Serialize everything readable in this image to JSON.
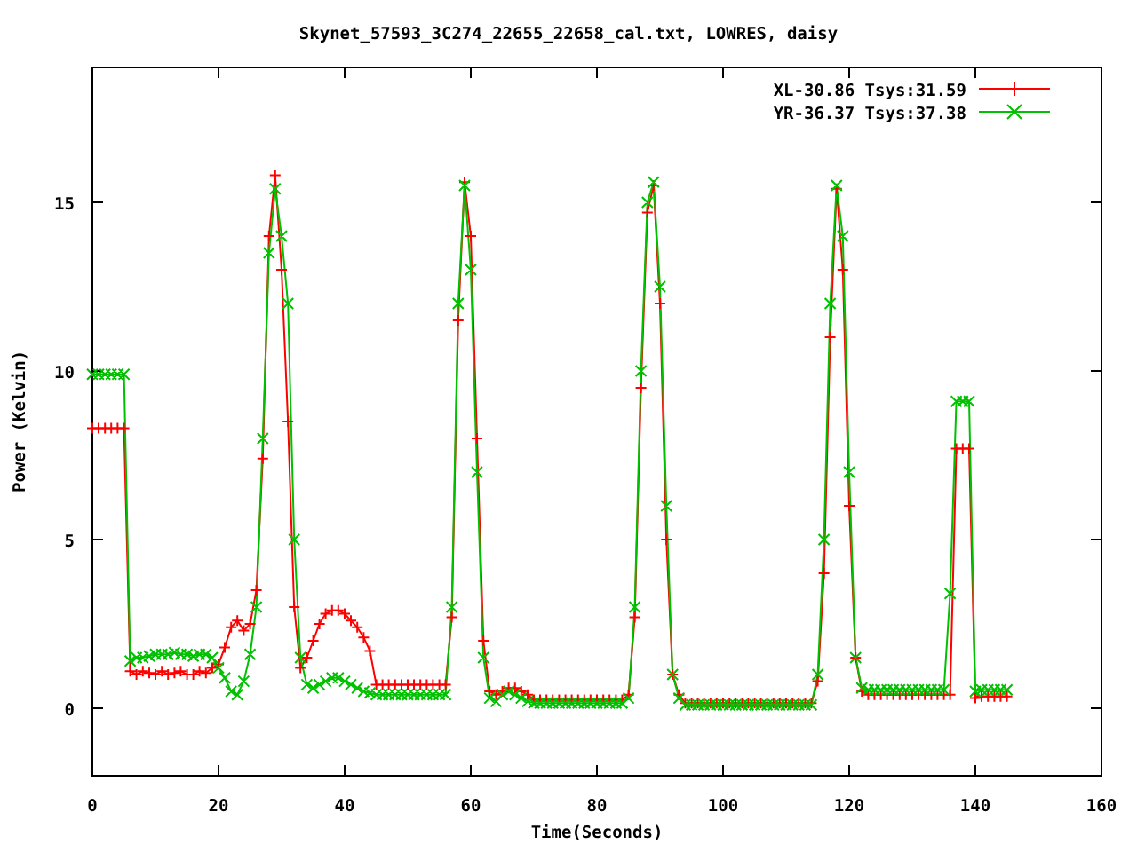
{
  "plot": {
    "chart_data": {
      "type": "line",
      "title": "Skynet_57593_3C274_22655_22658_cal.txt, LOWRES, daisy",
      "xlabel": "Time(Seconds)",
      "ylabel": "Power (Kelvin)",
      "x": [
        0,
        1,
        2,
        3,
        4,
        5,
        6,
        7,
        8,
        9,
        10,
        11,
        12,
        13,
        14,
        15,
        16,
        17,
        18,
        19,
        20,
        21,
        22,
        23,
        24,
        25,
        26,
        27,
        28,
        29,
        30,
        31,
        32,
        33,
        34,
        35,
        36,
        37,
        38,
        39,
        40,
        41,
        42,
        43,
        44,
        45,
        46,
        47,
        48,
        49,
        50,
        51,
        52,
        53,
        54,
        55,
        56,
        57,
        58,
        59,
        60,
        61,
        62,
        63,
        64,
        65,
        66,
        67,
        68,
        69,
        70,
        71,
        72,
        73,
        74,
        75,
        76,
        77,
        78,
        79,
        80,
        81,
        82,
        83,
        84,
        85,
        86,
        87,
        88,
        89,
        90,
        91,
        92,
        93,
        94,
        95,
        96,
        97,
        98,
        99,
        100,
        101,
        102,
        103,
        104,
        105,
        106,
        107,
        108,
        109,
        110,
        111,
        112,
        113,
        114,
        115,
        116,
        117,
        118,
        119,
        120,
        121,
        122,
        123,
        124,
        125,
        126,
        127,
        128,
        129,
        130,
        131,
        132,
        133,
        134,
        135,
        136,
        137,
        138,
        139,
        140,
        141,
        142,
        143,
        144,
        145
      ],
      "series": [
        {
          "name": "XL-30.86 Tsys:31.59",
          "color": "#ff0000",
          "marker": "plus",
          "values": [
            8.3,
            8.3,
            8.3,
            8.3,
            8.3,
            8.3,
            1.1,
            1.0,
            1.1,
            1.05,
            1.0,
            1.1,
            1.0,
            1.05,
            1.1,
            1.0,
            1.0,
            1.1,
            1.05,
            1.2,
            1.3,
            1.8,
            2.4,
            2.6,
            2.3,
            2.5,
            3.5,
            7.4,
            14,
            15.8,
            13,
            8.5,
            3,
            1.2,
            1.5,
            2,
            2.5,
            2.8,
            2.9,
            2.9,
            2.8,
            2.6,
            2.4,
            2.1,
            1.7,
            0.7,
            0.7,
            0.7,
            0.7,
            0.7,
            0.7,
            0.7,
            0.7,
            0.7,
            0.7,
            0.7,
            0.7,
            2.7,
            11.5,
            15.6,
            14,
            8,
            2,
            0.5,
            0.4,
            0.5,
            0.6,
            0.6,
            0.5,
            0.4,
            0.25,
            0.25,
            0.25,
            0.25,
            0.25,
            0.25,
            0.25,
            0.25,
            0.25,
            0.25,
            0.25,
            0.25,
            0.25,
            0.25,
            0.25,
            0.4,
            2.7,
            9.5,
            14.7,
            15.5,
            12,
            5,
            1,
            0.4,
            0.15,
            0.15,
            0.15,
            0.15,
            0.15,
            0.15,
            0.15,
            0.15,
            0.15,
            0.15,
            0.15,
            0.15,
            0.15,
            0.15,
            0.15,
            0.15,
            0.15,
            0.15,
            0.15,
            0.15,
            0.15,
            0.8,
            4,
            11,
            15.4,
            13,
            6,
            1.5,
            0.5,
            0.4,
            0.4,
            0.4,
            0.4,
            0.4,
            0.4,
            0.4,
            0.4,
            0.4,
            0.4,
            0.4,
            0.4,
            0.4,
            0.4,
            7.7,
            7.7,
            7.7,
            0.3,
            0.35,
            0.35,
            0.35,
            0.35,
            0.35
          ]
        },
        {
          "name": "YR-36.37 Tsys:37.38",
          "color": "#00c000",
          "marker": "x",
          "values": [
            9.9,
            9.9,
            9.9,
            9.9,
            9.9,
            9.9,
            1.4,
            1.5,
            1.5,
            1.55,
            1.6,
            1.6,
            1.6,
            1.65,
            1.6,
            1.6,
            1.55,
            1.6,
            1.6,
            1.5,
            1.2,
            0.9,
            0.5,
            0.4,
            0.8,
            1.6,
            3,
            8,
            13.5,
            15.4,
            14,
            12,
            5,
            1.5,
            0.7,
            0.6,
            0.7,
            0.8,
            0.9,
            0.9,
            0.8,
            0.7,
            0.6,
            0.5,
            0.45,
            0.4,
            0.4,
            0.4,
            0.4,
            0.4,
            0.4,
            0.4,
            0.4,
            0.4,
            0.4,
            0.4,
            0.4,
            3,
            12,
            15.5,
            13,
            7,
            1.5,
            0.3,
            0.2,
            0.4,
            0.5,
            0.4,
            0.3,
            0.2,
            0.15,
            0.15,
            0.15,
            0.15,
            0.15,
            0.15,
            0.15,
            0.15,
            0.15,
            0.15,
            0.15,
            0.15,
            0.15,
            0.15,
            0.15,
            0.3,
            3,
            10,
            15,
            15.6,
            12.5,
            6,
            1,
            0.3,
            0.1,
            0.1,
            0.1,
            0.1,
            0.1,
            0.1,
            0.1,
            0.1,
            0.1,
            0.1,
            0.1,
            0.1,
            0.1,
            0.1,
            0.1,
            0.1,
            0.1,
            0.1,
            0.1,
            0.1,
            0.1,
            1,
            5,
            12,
            15.5,
            14,
            7,
            1.5,
            0.6,
            0.55,
            0.55,
            0.55,
            0.55,
            0.55,
            0.55,
            0.55,
            0.55,
            0.55,
            0.55,
            0.55,
            0.55,
            0.55,
            3.4,
            9.1,
            9.1,
            9.1,
            0.5,
            0.55,
            0.55,
            0.55,
            0.55,
            0.55
          ]
        }
      ],
      "legend": true,
      "xlim": [
        0,
        160
      ],
      "ylim": [
        -2,
        19
      ],
      "xticks": [
        0,
        20,
        40,
        60,
        80,
        100,
        120,
        140,
        160
      ],
      "yticks": [
        0,
        5,
        10,
        15
      ]
    }
  }
}
